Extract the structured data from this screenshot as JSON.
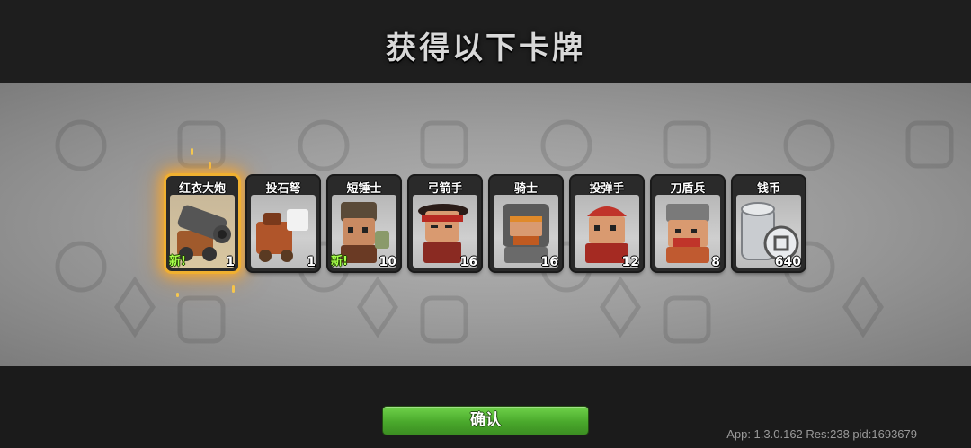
{
  "header": {
    "title": "获得以下卡牌"
  },
  "cards": [
    {
      "name": "红衣大炮",
      "count": "1",
      "is_new": true,
      "new_label": "新!",
      "highlight": true,
      "icon": "cannon-icon"
    },
    {
      "name": "投石弩",
      "count": "1",
      "is_new": false,
      "new_label": "",
      "highlight": false,
      "icon": "ballista-icon"
    },
    {
      "name": "短锤士",
      "count": "10",
      "is_new": true,
      "new_label": "新!",
      "highlight": false,
      "icon": "hammer-warrior-icon"
    },
    {
      "name": "弓箭手",
      "count": "16",
      "is_new": false,
      "new_label": "",
      "highlight": false,
      "icon": "archer-icon"
    },
    {
      "name": "骑士",
      "count": "16",
      "is_new": false,
      "new_label": "",
      "highlight": false,
      "icon": "knight-icon"
    },
    {
      "name": "投弹手",
      "count": "12",
      "is_new": false,
      "new_label": "",
      "highlight": false,
      "icon": "bomber-icon"
    },
    {
      "name": "刀盾兵",
      "count": "8",
      "is_new": false,
      "new_label": "",
      "highlight": false,
      "icon": "shield-soldier-icon"
    },
    {
      "name": "钱币",
      "count": "640",
      "is_new": false,
      "new_label": "",
      "highlight": false,
      "icon": "coin-stack-icon"
    }
  ],
  "footer": {
    "confirm_label": "确认",
    "version_text": "App: 1.3.0.162 Res:238 pid:1693679"
  },
  "colors": {
    "accent_green": "#4aa92c",
    "highlight_gold": "#f0b030",
    "new_text": "#a6ff4a"
  }
}
